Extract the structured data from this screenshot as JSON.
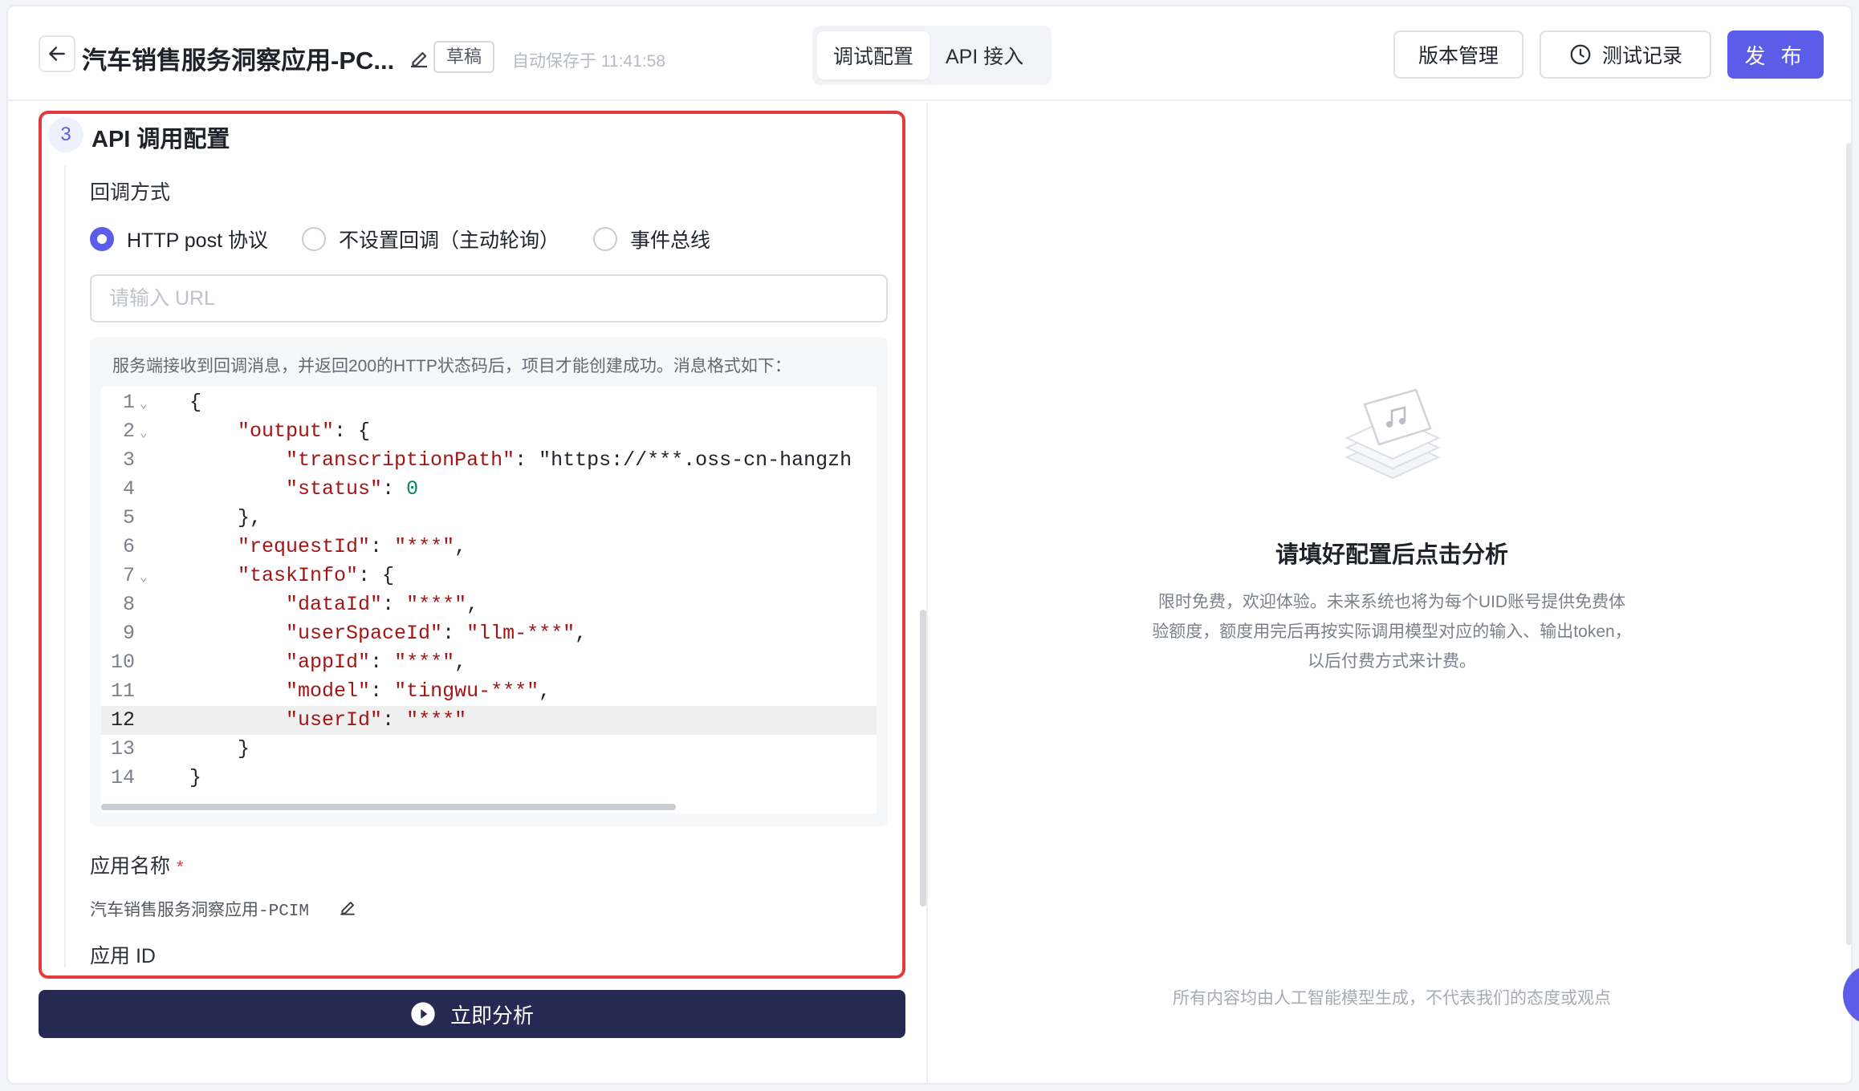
{
  "header": {
    "title": "汽车销售服务洞察应用-PC...",
    "badge": "草稿",
    "autosave": "自动保存于 11:41:58",
    "tabs": [
      {
        "label": "调试配置",
        "active": true
      },
      {
        "label": "API 接入",
        "active": false
      }
    ],
    "version_button": "版本管理",
    "records_button": "测试记录",
    "publish_button": "发 布"
  },
  "left": {
    "step_number": "3",
    "section_title": "API 调用配置",
    "callback_label": "回调方式",
    "callback_options": [
      {
        "label": "HTTP post 协议",
        "checked": true
      },
      {
        "label": "不设置回调（主动轮询）",
        "checked": false
      },
      {
        "label": "事件总线",
        "checked": false
      }
    ],
    "url_placeholder": "请输入 URL",
    "code_description": "服务端接收到回调消息，并返回200的HTTP状态码后，项目才能创建成功。消息格式如下：",
    "code_highlight_line": 12,
    "app_name_label": "应用名称",
    "app_name_required": "*",
    "app_name_value": "汽车销售服务洞察应用-PCIM",
    "app_id_label": "应用 ID",
    "analyze_button": "立即分析"
  },
  "code_lines": [
    {
      "num": "1",
      "fold": true,
      "text": "{"
    },
    {
      "num": "2",
      "fold": true,
      "text": "    \"output\": {"
    },
    {
      "num": "3",
      "fold": false,
      "text": "        \"transcriptionPath\": \"https://***.oss-cn-hangzh"
    },
    {
      "num": "4",
      "fold": false,
      "text": "        \"status\": 0"
    },
    {
      "num": "5",
      "fold": false,
      "text": "    },"
    },
    {
      "num": "6",
      "fold": false,
      "text": "    \"requestId\": \"***\","
    },
    {
      "num": "7",
      "fold": true,
      "text": "    \"taskInfo\": {"
    },
    {
      "num": "8",
      "fold": false,
      "text": "        \"dataId\": \"***\","
    },
    {
      "num": "9",
      "fold": false,
      "text": "        \"userSpaceId\": \"llm-***\","
    },
    {
      "num": "10",
      "fold": false,
      "text": "        \"appId\": \"***\","
    },
    {
      "num": "11",
      "fold": false,
      "text": "        \"model\": \"tingwu-***\","
    },
    {
      "num": "12",
      "fold": false,
      "text": "        \"userId\": \"***\""
    },
    {
      "num": "13",
      "fold": false,
      "text": "    }"
    },
    {
      "num": "14",
      "fold": false,
      "text": "}"
    }
  ],
  "right": {
    "empty_title": "请填好配置后点击分析",
    "empty_description": "限时免费，欢迎体验。未来系统也将为每个UID账号提供免费体验额度，额度用完后再按实际调用模型对应的输入、输出token，以后付费方式来计费。",
    "disclaimer": "所有内容均由人工智能模型生成，不代表我们的态度或观点"
  },
  "icons": {
    "back": "arrow-left-icon",
    "edit": "pencil-icon",
    "clock": "clock-icon",
    "play": "play-circle-icon",
    "empty": "music-card-stack-icon"
  },
  "colors": {
    "primary": "#5b5ce8",
    "highlight_border": "#e23b3b",
    "analyze_button": "#262a52"
  }
}
